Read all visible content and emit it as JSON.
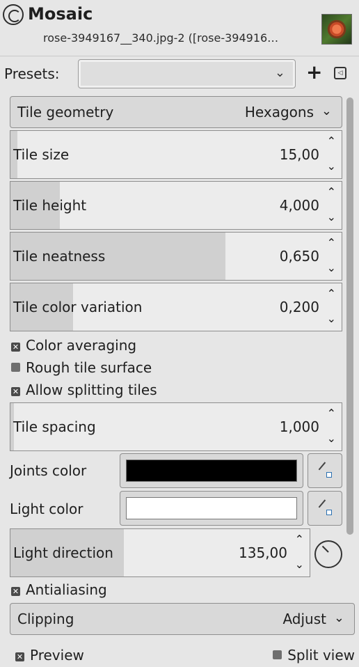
{
  "header": {
    "title": "Mosaic",
    "subtitle": "rose-3949167__340.jpg-2 ([rose-394916…",
    "icon": "gimp-filter-icon",
    "thumbnail": "rose-thumbnail"
  },
  "presets": {
    "label": "Presets:",
    "value": "",
    "add_icon": "+",
    "menu_icon": "◁"
  },
  "tile_geometry": {
    "label": "Tile geometry",
    "value": "Hexagons",
    "chevron": "⌄"
  },
  "tile_size": {
    "label": "Tile size",
    "value": "15,00",
    "level": 0.02
  },
  "tile_height": {
    "label": "Tile height",
    "value": "4,000",
    "level": 0.15
  },
  "tile_neatness": {
    "label": "Tile neatness",
    "value": "0,650",
    "level": 0.65
  },
  "tile_color_variation": {
    "label": "Tile color variation",
    "value": "0,200",
    "level": 0.19
  },
  "color_averaging": {
    "label": "Color averaging",
    "checked": true
  },
  "rough_tile_surface": {
    "label": "Rough tile surface",
    "checked": false
  },
  "allow_splitting_tiles": {
    "label": "Allow splitting tiles",
    "checked": true
  },
  "tile_spacing": {
    "label": "Tile spacing",
    "value": "1,000",
    "level": 0.01
  },
  "joints_color": {
    "label": "Joints color",
    "color": "#000000"
  },
  "light_color": {
    "label": "Light color",
    "color": "#ffffff"
  },
  "light_direction": {
    "label": "Light direction",
    "value": "135,00",
    "level": 0.38
  },
  "antialiasing": {
    "label": "Antialiasing",
    "checked": true
  },
  "clipping": {
    "label": "Clipping",
    "value": "Adjust"
  },
  "preview": {
    "label": "Preview",
    "checked": true
  },
  "split_view": {
    "label": "Split view",
    "checked": false
  },
  "spin_up": "⌃",
  "spin_down": "⌄",
  "check_mark": "✕"
}
